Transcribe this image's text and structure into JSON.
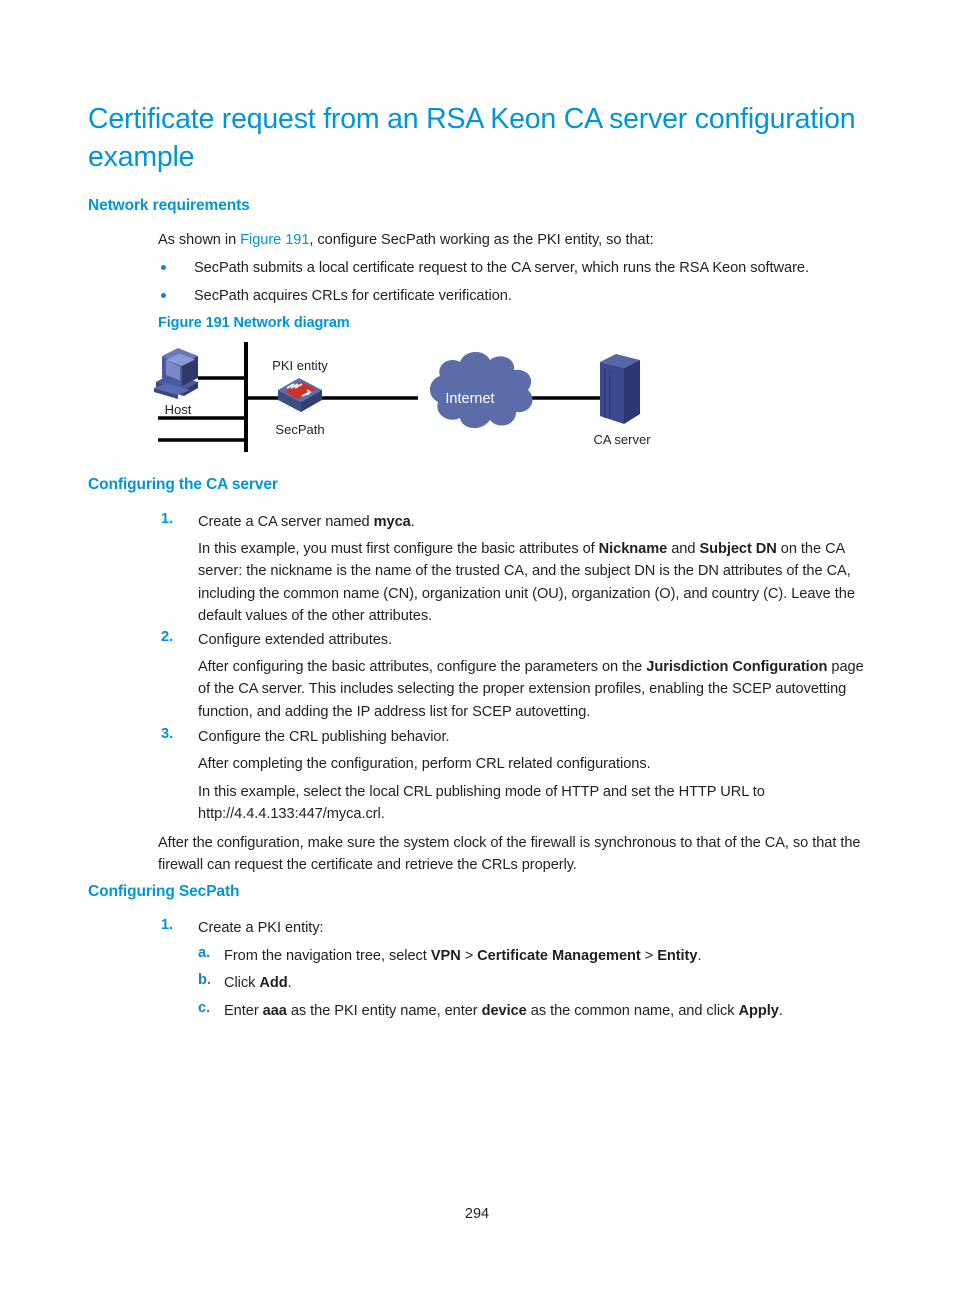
{
  "document": {
    "title": "Certificate request from an RSA Keon CA server configuration example",
    "page_number": "294"
  },
  "sections": {
    "network_requirements": {
      "heading": "Network requirements",
      "intro_before_link": "As shown in ",
      "intro_link": "Figure 191",
      "intro_after_link": ", configure SecPath working as the PKI entity, so that:",
      "bullets": [
        "SecPath submits a local certificate request to the CA server, which runs the RSA Keon software.",
        "SecPath acquires CRLs for certificate verification."
      ],
      "figure_caption": "Figure 191 Network diagram"
    },
    "configuring_ca_server": {
      "heading": "Configuring the CA server",
      "steps": [
        {
          "marker": "1.",
          "title_before_bold": "Create a CA server named ",
          "title_bold": "myca",
          "title_after_bold": ".",
          "body": [
            "In this example, you must first configure the basic attributes of <b>Nickname</b> and <b>Subject DN</b> on the CA server: the nickname is the name of the trusted CA, and the subject DN is the DN attributes of the CA, including the common name (CN), organization unit (OU), organization (O), and country (C). Leave the default values of the other attributes."
          ]
        },
        {
          "marker": "2.",
          "title": "Configure extended attributes.",
          "body": [
            "After configuring the basic attributes, configure the parameters on the <b>Jurisdiction Configuration</b> page of the CA server. This includes selecting the proper extension profiles, enabling the SCEP autovetting function, and adding the IP address list for SCEP autovetting."
          ]
        },
        {
          "marker": "3.",
          "title": "Configure the CRL publishing behavior.",
          "body": [
            "After completing the configuration, perform CRL related configurations.",
            "In this example, select the local CRL publishing mode of HTTP and set the HTTP URL to http://4.4.4.133:447/myca.crl."
          ]
        }
      ],
      "closing_paragraph": "After the configuration, make sure the system clock of the firewall is synchronous to that of the CA, so that the firewall can request the certificate and retrieve the CRLs properly."
    },
    "configuring_secpath": {
      "heading": "Configuring SecPath",
      "steps": [
        {
          "marker": "1.",
          "title": "Create a PKI entity:",
          "substeps": [
            {
              "marker": "a.",
              "html": "From the navigation tree, select <b>VPN</b> > <b>Certificate Management</b> > <b>Entity</b>."
            },
            {
              "marker": "b.",
              "html": "Click <b>Add</b>."
            },
            {
              "marker": "c.",
              "html": "Enter <b>aaa</b> as the PKI entity name, enter <b>device</b> as the common name, and click <b>Apply</b>."
            }
          ]
        }
      ]
    }
  },
  "diagram": {
    "labels": {
      "host": "Host",
      "pki_entity": "PKI entity",
      "secpath": "SecPath",
      "internet": "Internet",
      "ca_server": "CA server"
    },
    "colors": {
      "device_blue": "#3b4a8f",
      "device_light": "#7b8ac4",
      "cloud": "#5b6ca8",
      "line": "#000000"
    }
  },
  "theme": {
    "accent_blue": "#0096d6",
    "marker_blue": "#1287c8",
    "body_text": "#231f20"
  }
}
